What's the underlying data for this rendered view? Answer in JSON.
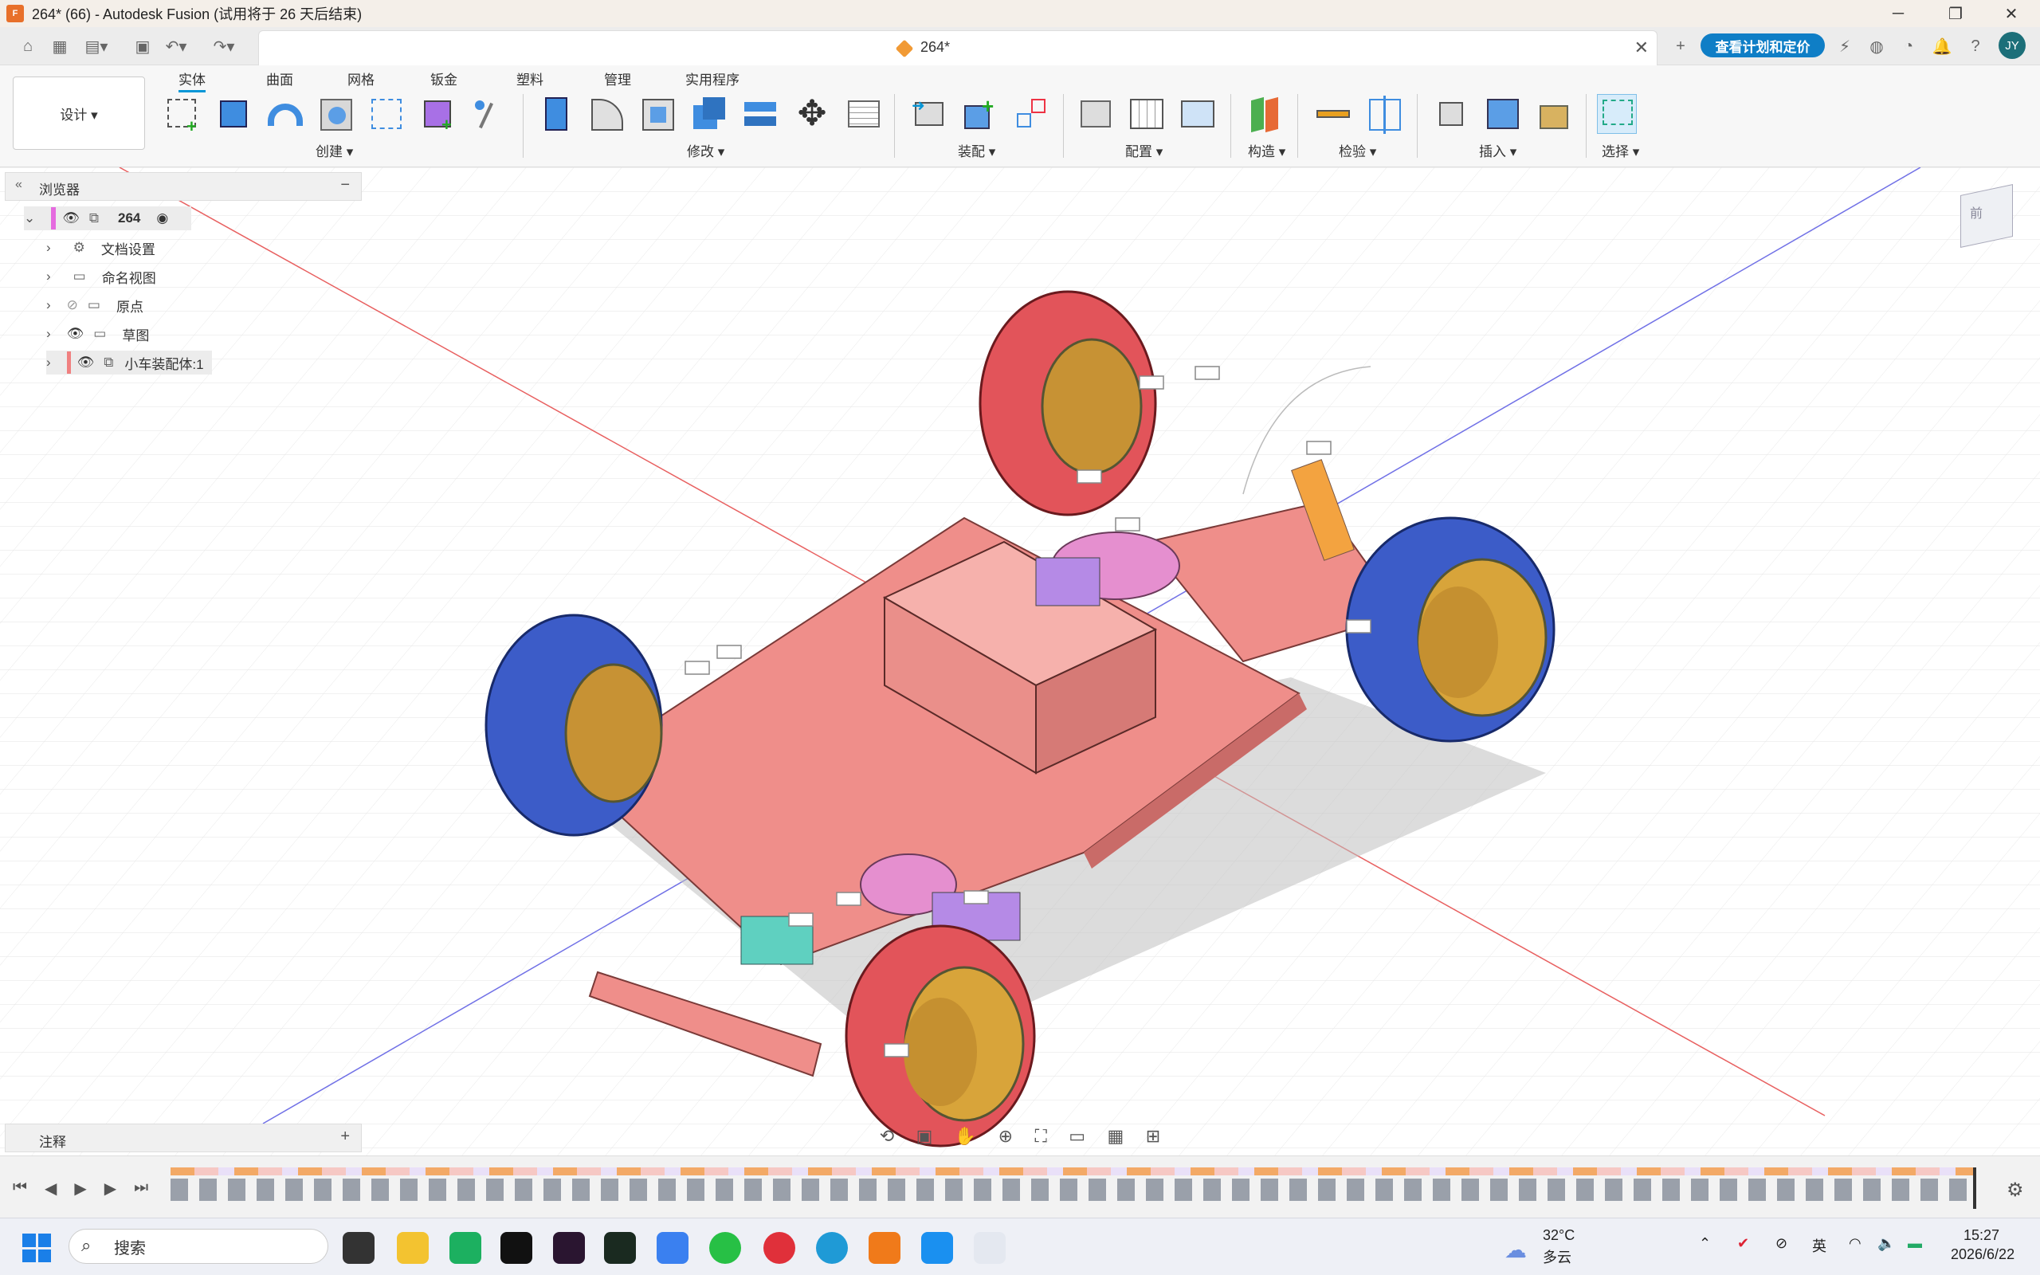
{
  "title": "264* (66) - Autodesk Fusion (试用将于 26 天后结束)",
  "doc_tab": "264*",
  "plan_button": "查看计划和定价",
  "user_initials": "JY",
  "ribbon": {
    "tabs": [
      "实体",
      "曲面",
      "网格",
      "钣金",
      "塑料",
      "管理",
      "实用程序"
    ],
    "workspace": "设计 ▾",
    "groups": [
      "创建 ▾",
      "修改 ▾",
      "装配 ▾",
      "配置 ▾",
      "构造 ▾",
      "检验 ▾",
      "插入 ▾",
      "选择 ▾"
    ]
  },
  "browser": {
    "title": "浏览器",
    "root": "264",
    "items": [
      "文档设置",
      "命名视图",
      "原点",
      "草图",
      "小车装配体:1"
    ]
  },
  "notes": "注释",
  "taskbar": {
    "search": "搜索",
    "weather_temp": "32°C",
    "weather_desc": "多云",
    "ime": "英",
    "time": "15:27",
    "date": "2026/6/22"
  },
  "colors": {
    "accent": "#0696d7",
    "plan": "#0f7ec6",
    "red_tire": "#e2545a",
    "blue_tire": "#3c5cc8",
    "chassis": "#ef8e8a"
  }
}
